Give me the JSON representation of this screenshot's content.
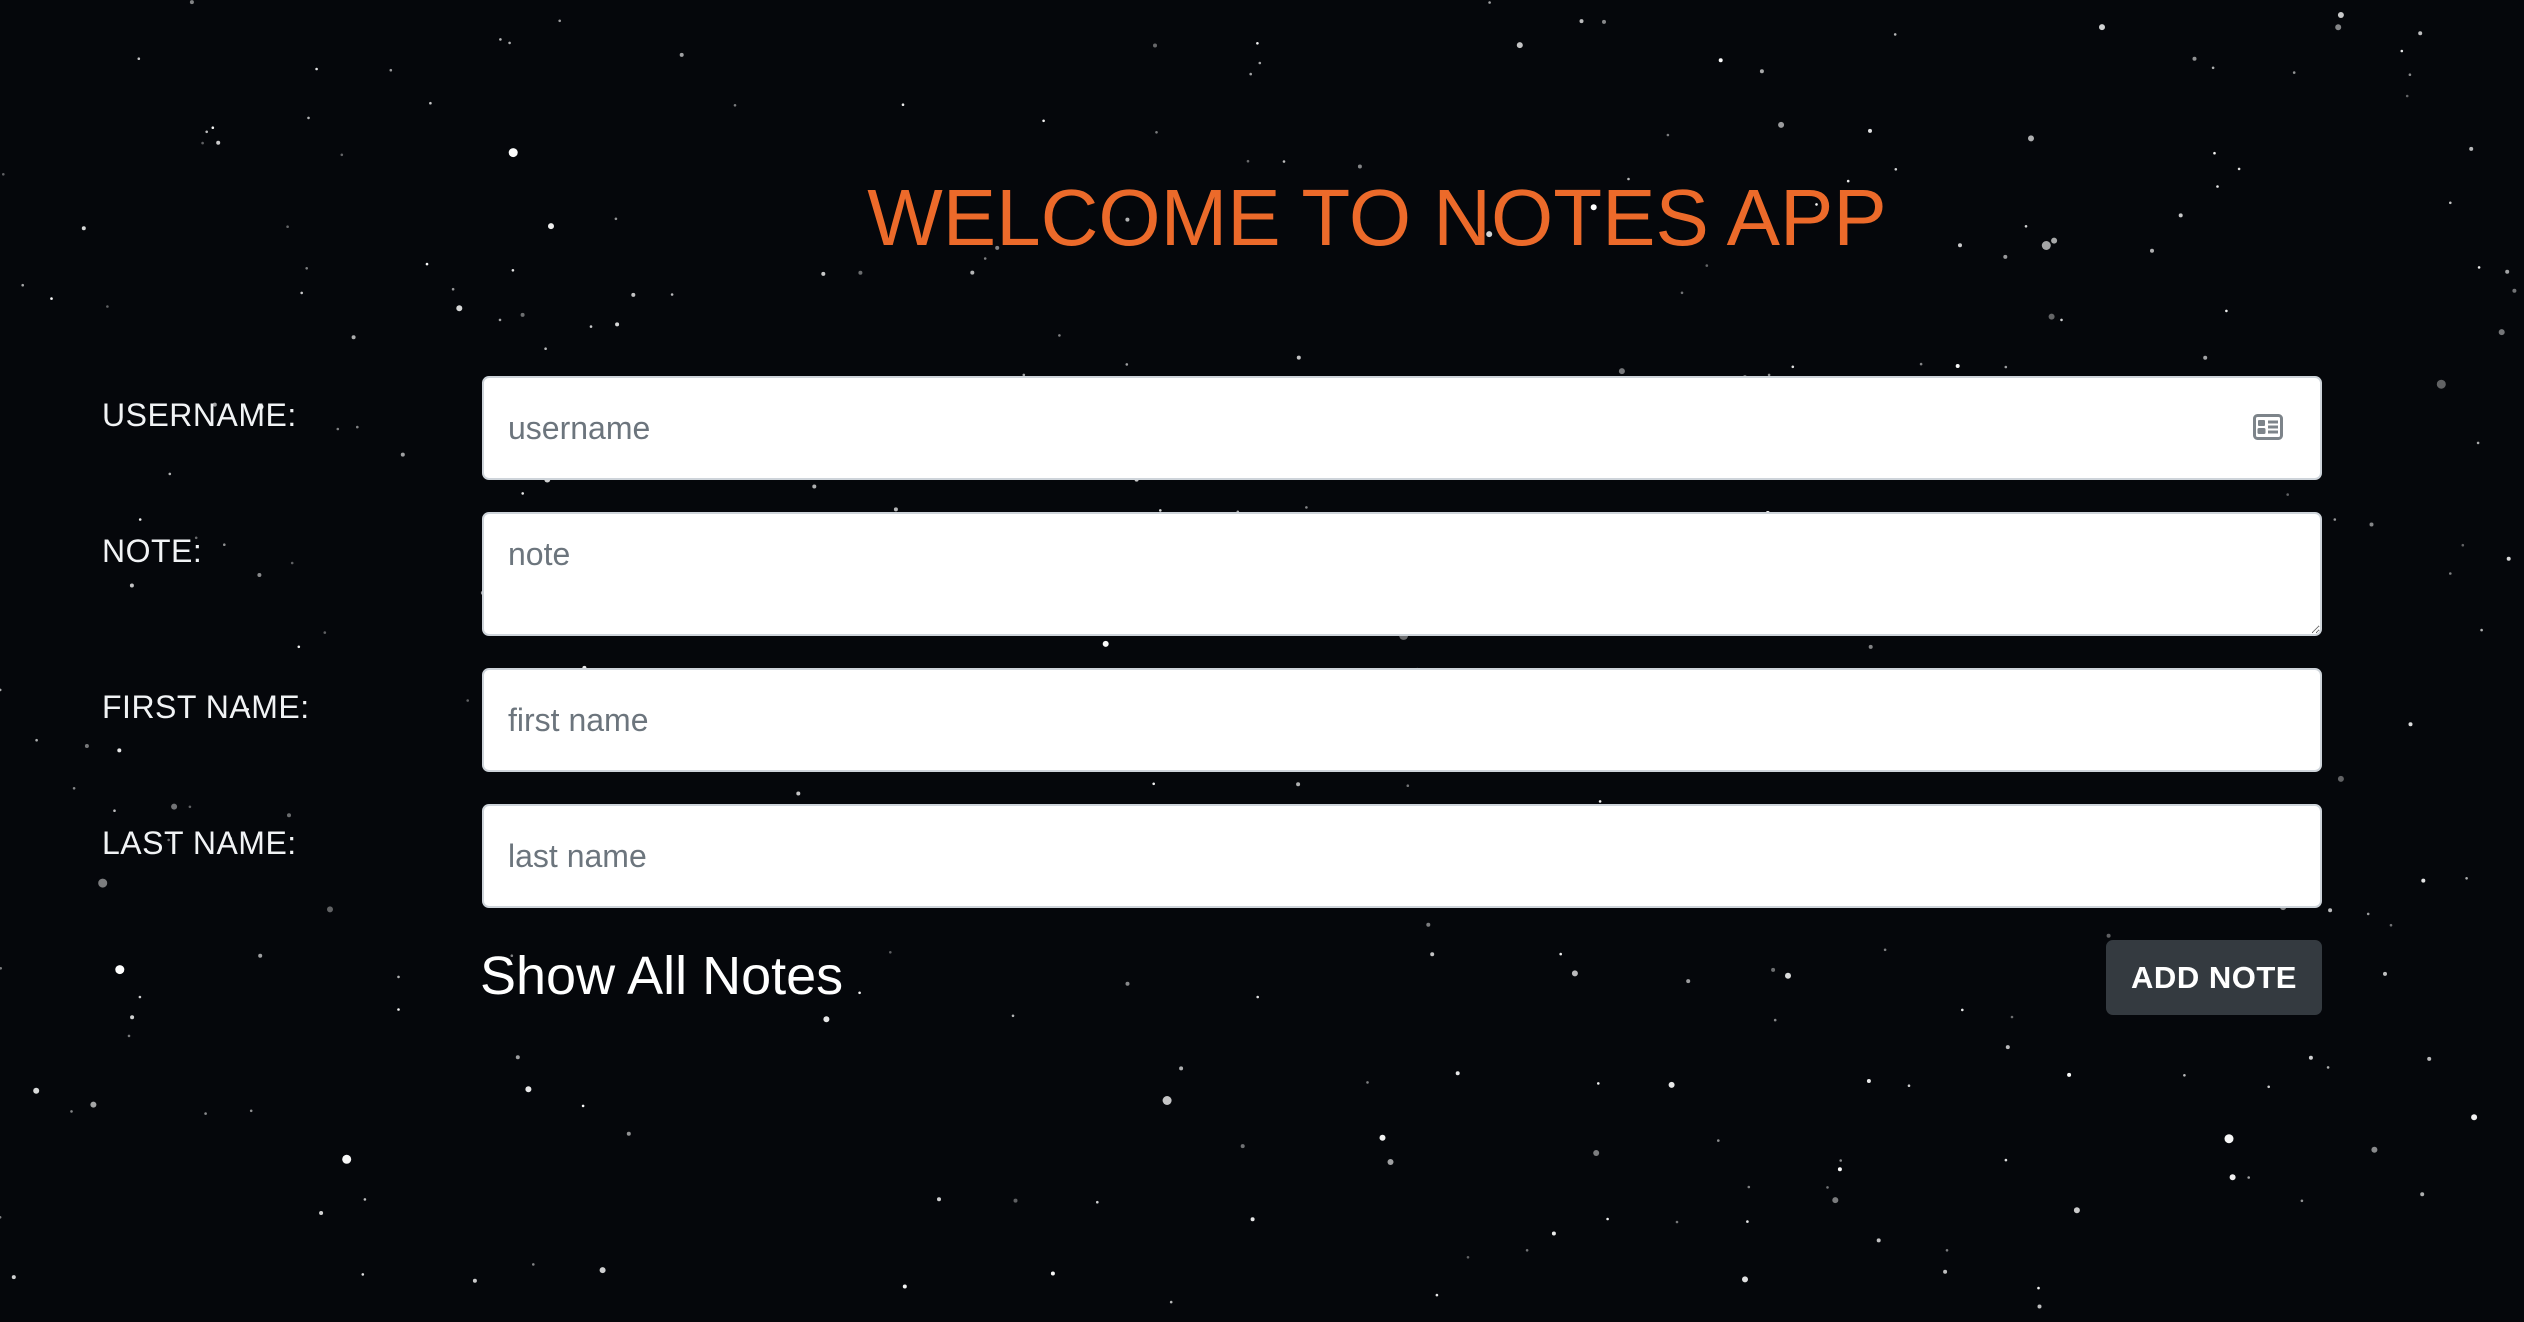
{
  "theme": {
    "background": "#05070b",
    "title_color": "#ec6a2a",
    "label_color": "#f1f3f5",
    "button_color": "#343a40"
  },
  "page": {
    "title": "WELCOME TO NOTES APP"
  },
  "form": {
    "username": {
      "label": "USERNAME:",
      "value": "",
      "placeholder": "username",
      "icon": "contact-card-icon"
    },
    "note": {
      "label": "NOTE:",
      "value": "",
      "placeholder": "note"
    },
    "first_name": {
      "label": "FIRST NAME:",
      "value": "",
      "placeholder": "first name"
    },
    "last_name": {
      "label": "LAST NAME:",
      "value": "",
      "placeholder": "last name"
    }
  },
  "actions": {
    "show_all_label": "Show All Notes",
    "add_note_label": "ADD NOTE"
  }
}
